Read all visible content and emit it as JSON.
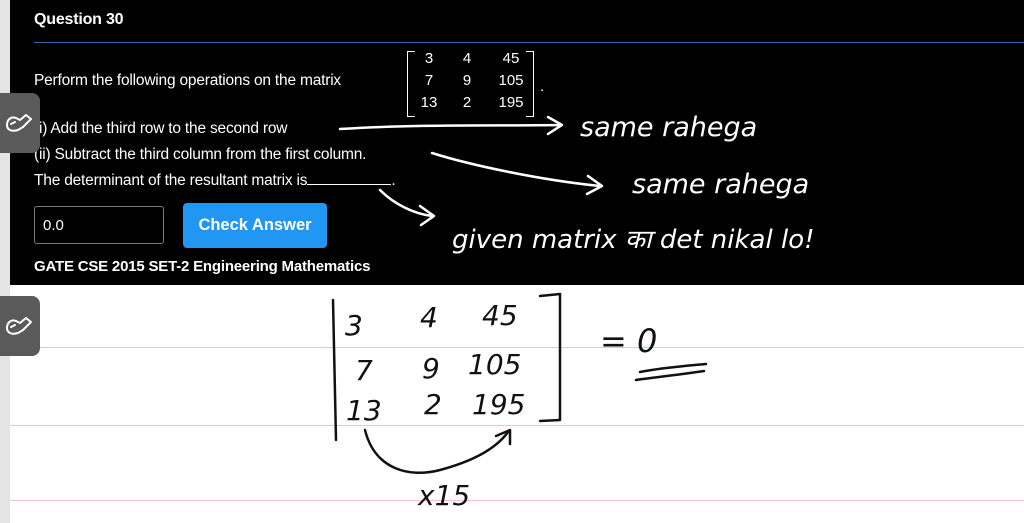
{
  "question": {
    "title": "Question 30",
    "prompt": "Perform the following operations on the matrix",
    "matrix": [
      [
        "3",
        "4",
        "45"
      ],
      [
        "7",
        "9",
        "105"
      ],
      [
        "13",
        "2",
        "195"
      ]
    ],
    "period": ".",
    "op1": "(i) Add the third row to the second row",
    "op2": "(ii) Subtract the third column from the first column.",
    "op3_prefix": "The determinant of the resultant matrix is",
    "op3_suffix": ".",
    "answer_value": "0.0",
    "check_label": "Check Answer",
    "tags": "GATE CSE 2015 SET-2  Engineering Mathematics"
  },
  "notes": {
    "note1": "same rahega",
    "note2": "same rahega",
    "note3": "given matrix का det nikal lo!",
    "det_matrix": [
      [
        "3",
        "4",
        "45"
      ],
      [
        "7",
        "9",
        "105"
      ],
      [
        "13",
        "2",
        "195"
      ]
    ],
    "equals": "= 0",
    "multiplier": "x15"
  },
  "colors": {
    "card": "#000000",
    "accent": "#2196f3",
    "rule": "#3b63b8",
    "paper_line": "#f0c4c4"
  },
  "icons": {
    "tool_button": "pen-hand-icon"
  }
}
